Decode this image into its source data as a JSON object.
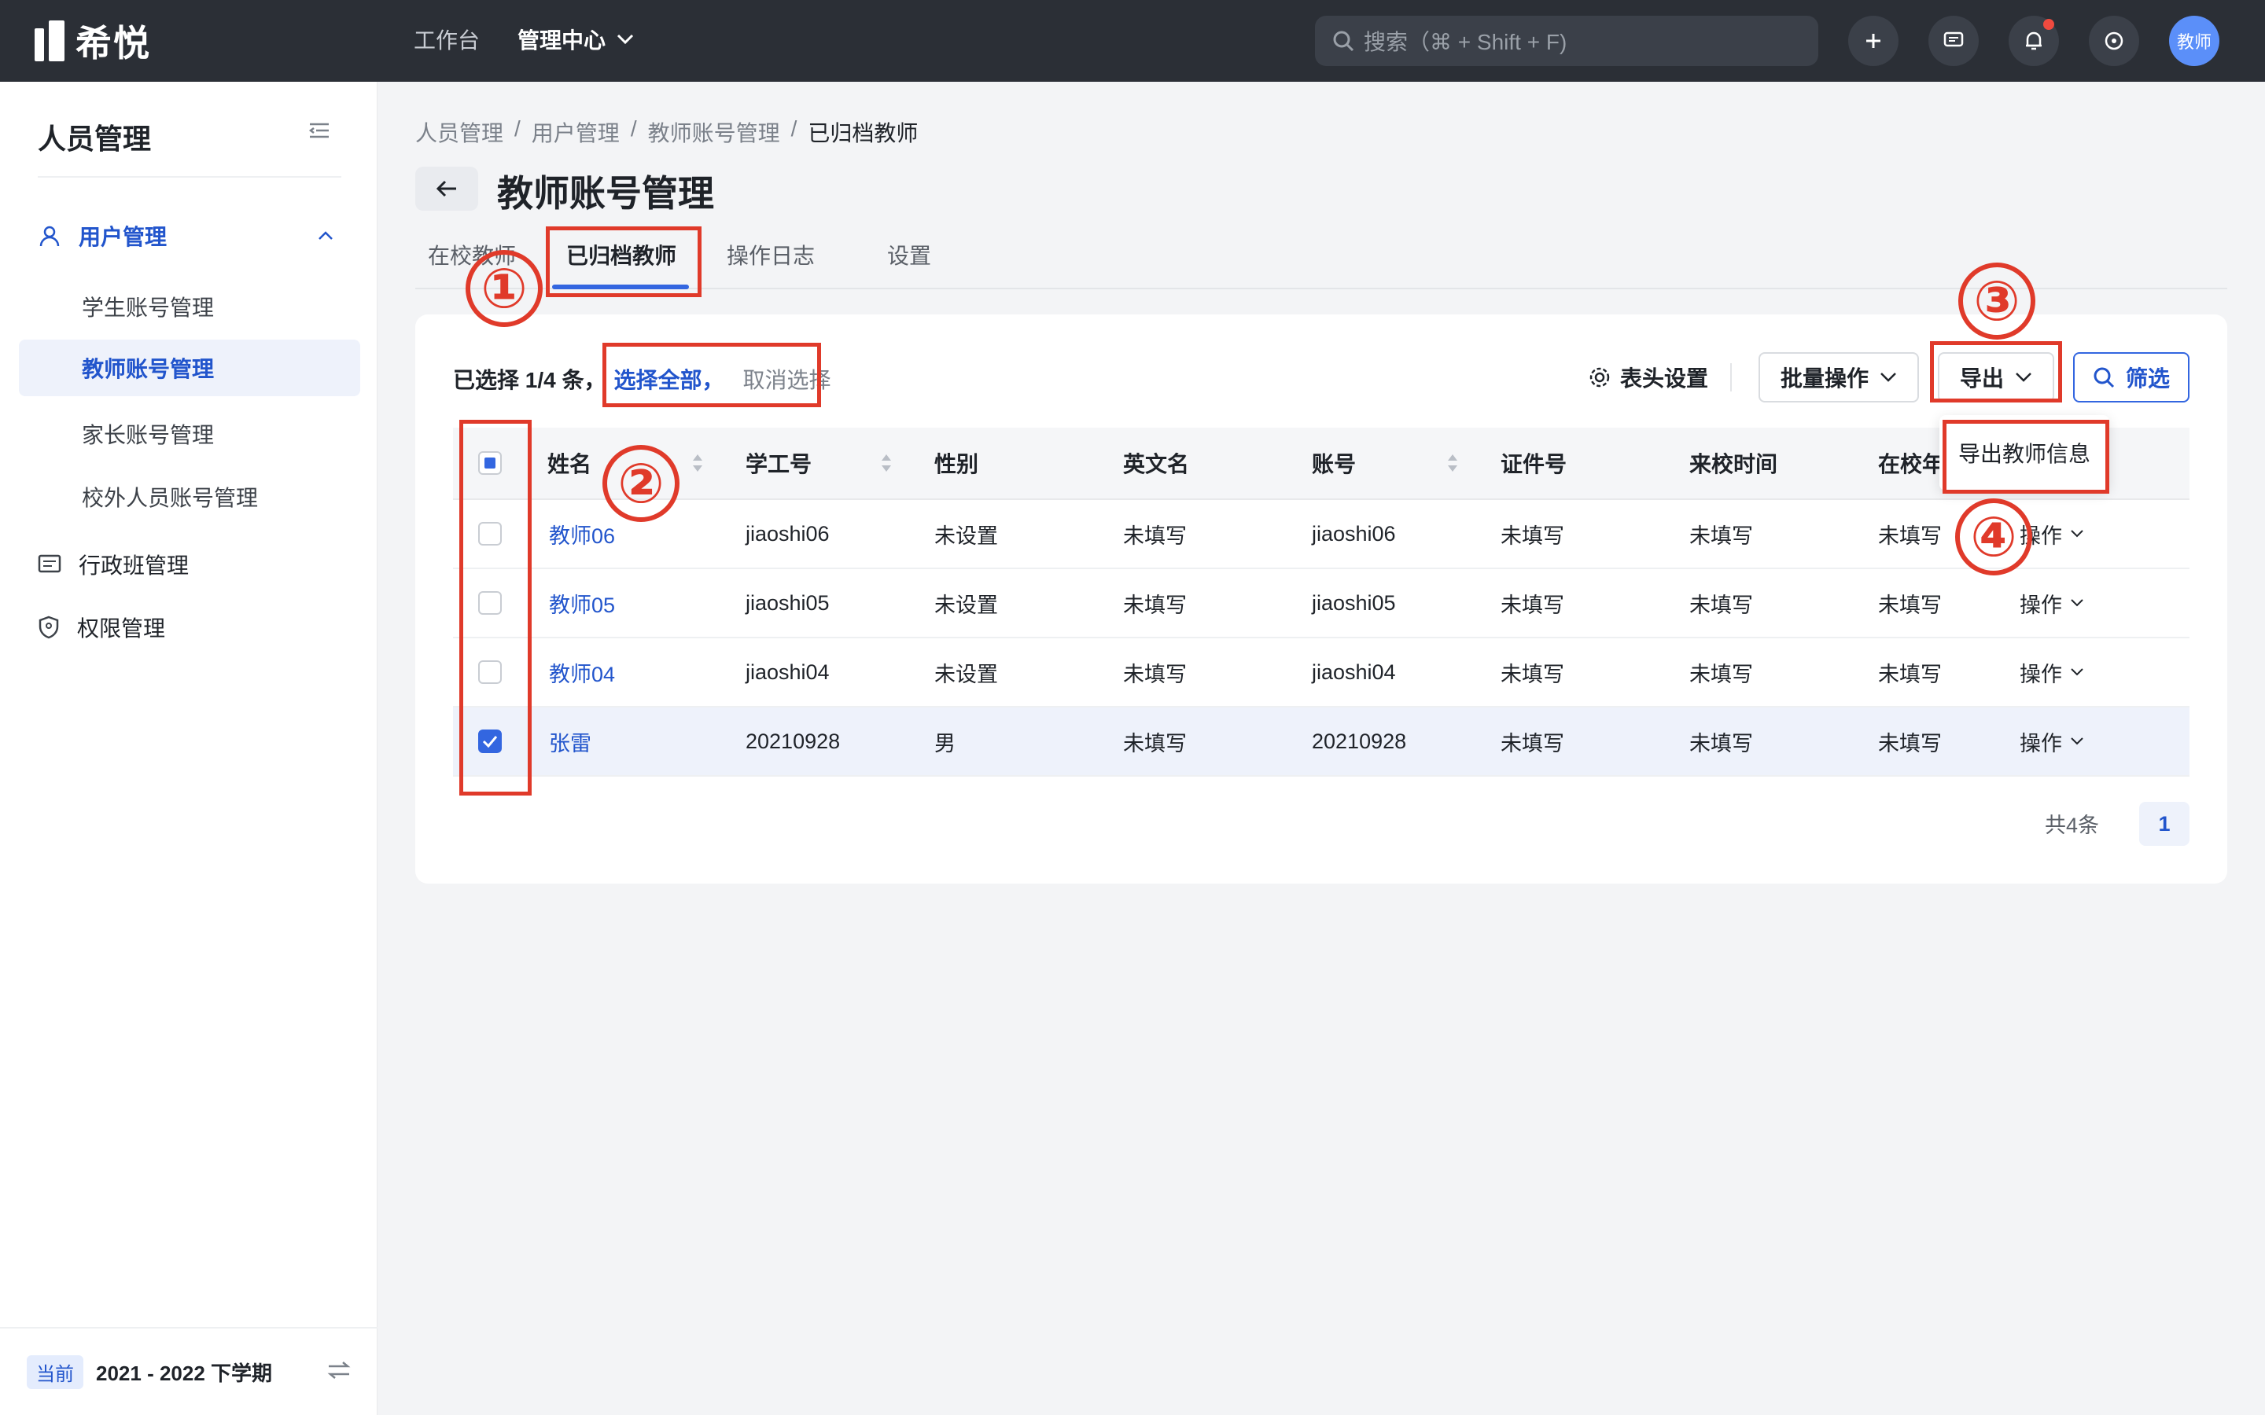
{
  "app": {
    "logo_text": "希悦"
  },
  "topnav": {
    "workbench": "工作台",
    "admin": "管理中心"
  },
  "search": {
    "placeholder": "搜索（⌘ + Shift + F)"
  },
  "user": {
    "avatar_label": "教师"
  },
  "sidebar": {
    "title": "人员管理",
    "group": "用户管理",
    "subitems": [
      "学生账号管理",
      "教师账号管理",
      "家长账号管理",
      "校外人员账号管理"
    ],
    "items": [
      "行政班管理",
      "权限管理"
    ],
    "footer_badge": "当前",
    "footer_term": "2021 - 2022 下学期"
  },
  "breadcrumb": [
    "人员管理",
    "用户管理",
    "教师账号管理",
    "已归档教师"
  ],
  "breadcrumb_sep": "/",
  "page_title": "教师账号管理",
  "tabs": [
    "在校教师",
    "已归档教师",
    "操作日志",
    "设置"
  ],
  "selection": {
    "count_text": "已选择 1/4 条，",
    "select_all": "选择全部，",
    "deselect": "取消选择"
  },
  "toolbar": {
    "header_settings": "表头设置",
    "batch": "批量操作",
    "export": "导出",
    "filter": "筛选"
  },
  "export_menu": {
    "item": "导出教师信息"
  },
  "table": {
    "headers": [
      "姓名",
      "学工号",
      "性别",
      "英文名",
      "账号",
      "证件号",
      "来校时间",
      "在校年"
    ],
    "rows": [
      {
        "name": "教师06",
        "id": "jiaoshi06",
        "gender": "未设置",
        "en": "未填写",
        "account": "jiaoshi06",
        "cert": "未填写",
        "date": "未填写",
        "years": "未填写",
        "ops": "操作"
      },
      {
        "name": "教师05",
        "id": "jiaoshi05",
        "gender": "未设置",
        "en": "未填写",
        "account": "jiaoshi05",
        "cert": "未填写",
        "date": "未填写",
        "years": "未填写",
        "ops": "操作"
      },
      {
        "name": "教师04",
        "id": "jiaoshi04",
        "gender": "未设置",
        "en": "未填写",
        "account": "jiaoshi04",
        "cert": "未填写",
        "date": "未填写",
        "years": "未填写",
        "ops": "操作"
      },
      {
        "name": "张雷",
        "id": "20210928",
        "gender": "男",
        "en": "未填写",
        "account": "20210928",
        "cert": "未填写",
        "date": "未填写",
        "years": "未填写",
        "ops": "操作"
      }
    ]
  },
  "pagination": {
    "total": "共4条",
    "page": "1"
  },
  "annotations": [
    "①",
    "②",
    "③",
    "④"
  ],
  "colors": {
    "accent": "#3366e0",
    "annotation": "#e03a2a",
    "topbar": "#2b2f36"
  }
}
